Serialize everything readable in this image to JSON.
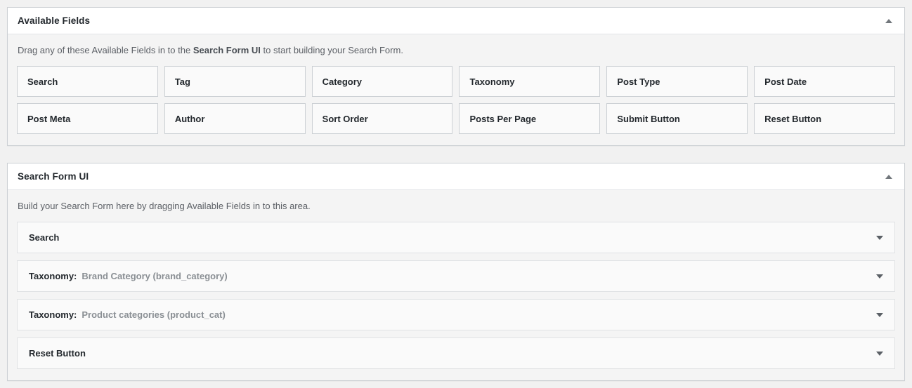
{
  "available_fields_panel": {
    "title": "Available Fields",
    "toggle_icon": "triangle-up-icon",
    "description_prefix": "Drag any of these Available Fields in to the ",
    "description_bold": "Search Form UI",
    "description_suffix": " to start building your Search Form.",
    "fields": [
      "Search",
      "Tag",
      "Category",
      "Taxonomy",
      "Post Type",
      "Post Date",
      "Post Meta",
      "Author",
      "Sort Order",
      "Posts Per Page",
      "Submit Button",
      "Reset Button"
    ]
  },
  "search_form_ui_panel": {
    "title": "Search Form UI",
    "toggle_icon": "triangle-up-icon",
    "description": "Build your Search Form here by dragging Available Fields in to this area.",
    "rows": [
      {
        "label": "Search",
        "value": "",
        "toggle_icon": "triangle-down-icon"
      },
      {
        "label": "Taxonomy:",
        "value": "Brand Category (brand_category)",
        "toggle_icon": "triangle-down-icon"
      },
      {
        "label": "Taxonomy:",
        "value": "Product categories (product_cat)",
        "toggle_icon": "triangle-down-icon"
      },
      {
        "label": "Reset Button",
        "value": "",
        "toggle_icon": "triangle-down-icon"
      }
    ]
  },
  "colors": {
    "page_background": "#f1f1f1",
    "panel_border": "#ccd0d4",
    "panel_header_background": "#ffffff",
    "panel_body_background": "#f4f4f4",
    "tile_background": "#fafafa",
    "text_primary": "#23282d",
    "text_muted": "#8a8f94"
  }
}
